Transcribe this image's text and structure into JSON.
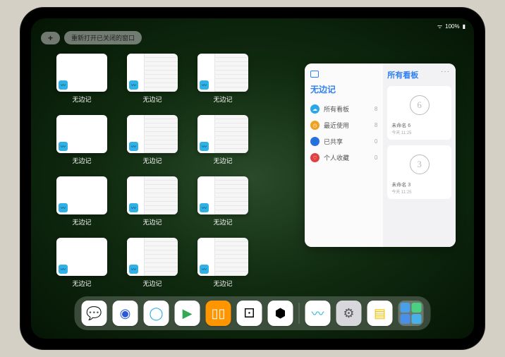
{
  "status": {
    "battery": "100%"
  },
  "controls": {
    "plus": "+",
    "reopen_label": "重新打开已关闭的窗口"
  },
  "app_name": "无边记",
  "thumbs": {
    "rows": [
      [
        "blank",
        "content",
        "content"
      ],
      [
        "blank",
        "content",
        "content"
      ],
      [
        "blank",
        "content",
        "content"
      ],
      [
        "blank",
        "content",
        "content"
      ]
    ]
  },
  "panel": {
    "title": "无边记",
    "right_title": "所有看板",
    "ellipsis": "···",
    "items": [
      {
        "color": "#2aa6ea",
        "glyph": "☁",
        "label": "所有看板",
        "count": "8"
      },
      {
        "color": "#f0a020",
        "glyph": "◷",
        "label": "最近使用",
        "count": "8"
      },
      {
        "color": "#2a6fe0",
        "glyph": "👤",
        "label": "已共享",
        "count": "0"
      },
      {
        "color": "#e04040",
        "glyph": "♡",
        "label": "个人收藏",
        "count": "0"
      }
    ],
    "boards": [
      {
        "sketch": "6",
        "name": "未命名 6",
        "time": "今天 11:25"
      },
      {
        "sketch": "3",
        "name": "未命名 3",
        "time": "今天 11:25"
      }
    ]
  },
  "dock": {
    "apps": [
      {
        "name": "wechat",
        "bg": "#ffffff",
        "glyph": "💬",
        "fg": "#07c160"
      },
      {
        "name": "browser1",
        "bg": "#ffffff",
        "glyph": "◉",
        "fg": "#2a58d8"
      },
      {
        "name": "qqbrowser",
        "bg": "#ffffff",
        "glyph": "◯",
        "fg": "#2fb1e6"
      },
      {
        "name": "play",
        "bg": "#ffffff",
        "glyph": "▶",
        "fg": "#34a853"
      },
      {
        "name": "books",
        "bg": "#ff9500",
        "glyph": "▯▯",
        "fg": "#fff"
      },
      {
        "name": "dice",
        "bg": "#ffffff",
        "glyph": "⚀",
        "fg": "#000"
      },
      {
        "name": "camera",
        "bg": "#ffffff",
        "glyph": "⬢",
        "fg": "#000"
      }
    ],
    "recent": [
      {
        "name": "freeform",
        "bg": "#ffffff",
        "glyph": "〰",
        "fg": "#2fb1e6"
      },
      {
        "name": "settings",
        "bg": "#d8d8dc",
        "glyph": "⚙",
        "fg": "#555"
      },
      {
        "name": "notes",
        "bg": "#ffffff",
        "glyph": "▤",
        "fg": "#f0c000"
      }
    ],
    "cluster_colors": [
      "#4aa0e8",
      "#4ad080",
      "#4a90e8",
      "#4ab0e8"
    ]
  }
}
